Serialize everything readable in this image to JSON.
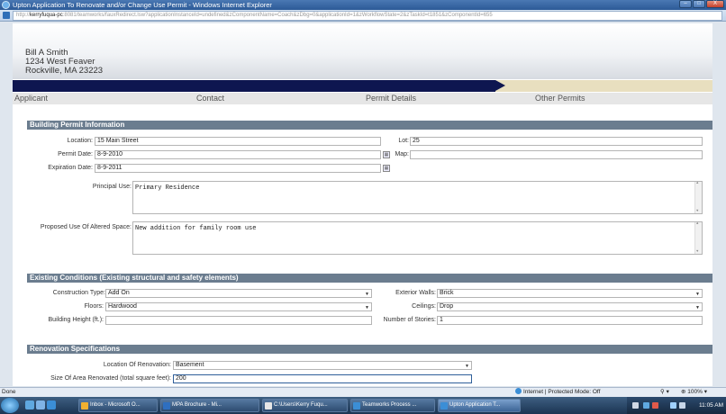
{
  "window": {
    "title": "Upton Application To Renovate and/or Change Use Permit - Windows Internet Explorer",
    "controls": [
      "–",
      "□",
      "X"
    ]
  },
  "address_bar": {
    "url_prefix": "http://",
    "url_host": "kerryfuqua-pc",
    "url_rest": ":8081/teamworks/fauxRedirect.lsw?applicationInstanceId=undefined&zComponentName=Coach&zDbg=0&applicationId=1&zWorkflowState=2&zTaskId=t1851&zComponentId=655"
  },
  "applicant_header": {
    "name": "Bill A Smith",
    "street": "1234 West Feaver",
    "city": "Rockville, MA 23223"
  },
  "progress": {
    "fraction": 0.69
  },
  "steps": [
    "Applicant",
    "Contact",
    "Permit Details",
    "Other Permits"
  ],
  "building_permit": {
    "section_title": "Building Permit Information",
    "location_label": "Location:",
    "location_value": "15 Main Street",
    "lot_label": "Lot:",
    "lot_value": "25",
    "permit_date_label": "Permit Date:",
    "permit_date_value": "8-9-2010",
    "map_label": "Map:",
    "map_value": "",
    "expiration_date_label": "Expiration Date:",
    "expiration_date_value": "8-9-2011",
    "principal_use_label": "Principal Use:",
    "principal_use_value": "Primary Residence",
    "proposed_use_label": "Proposed Use Of Altered Space:",
    "proposed_use_value": "New addition for family room use"
  },
  "existing_conditions": {
    "section_title": "Existing Conditions (Existing structural and safety elements)",
    "construction_type_label": "Construction Type:",
    "construction_type_value": "Add On",
    "exterior_walls_label": "Exterior Walls:",
    "exterior_walls_value": "Brick",
    "floors_label": "Floors:",
    "floors_value": "Hardwood",
    "ceilings_label": "Ceilings:",
    "ceilings_value": "Drop",
    "building_height_label": "Building Height (ft.):",
    "building_height_value": "",
    "stories_label": "Number of Stories:",
    "stories_value": "1"
  },
  "renovation": {
    "section_title": "Renovation Specifications",
    "location_label": "Location Of Renovation:",
    "location_value": "Basement",
    "size_label": "Size Of Area Renovated (total square feet):",
    "size_value": "200"
  },
  "status_bar": {
    "status": "Done",
    "zone": "Internet | Protected Mode: Off",
    "zoom": "100%"
  },
  "taskbar": {
    "tasks": [
      "Inbox - Microsoft O...",
      "MPA Brochure - Mi...",
      "C:\\Users\\Kerry Fuqu...",
      "Teamworks Process ...",
      "Upton Application T..."
    ],
    "clock": "11:05 AM"
  },
  "colors": {
    "progress_done": "#0e1650",
    "progress_remaining": "#e8dfbf",
    "section_bar": "#6b7d8f"
  }
}
